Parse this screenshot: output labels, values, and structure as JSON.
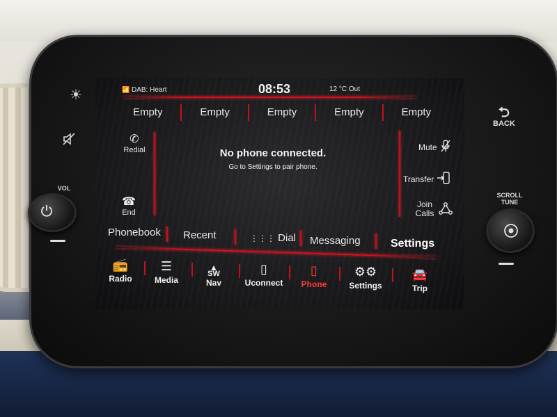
{
  "status": {
    "source": "DAB: Heart",
    "time": "08:53",
    "temperature": "12 °C Out"
  },
  "presets": [
    "Empty",
    "Empty",
    "Empty",
    "Empty",
    "Empty"
  ],
  "left_actions": {
    "redial": "Redial",
    "end": "End"
  },
  "right_actions": {
    "mute": "Mute",
    "transfer": "Transfer",
    "join_calls": "Join Calls"
  },
  "message": {
    "title": "No phone connected.",
    "subtitle": "Go to Settings to pair phone."
  },
  "tabs": [
    "Phonebook",
    "Recent",
    "Dial",
    "Messaging",
    "Settings"
  ],
  "active_tab": "Settings",
  "nav": [
    {
      "label": "Radio",
      "icon": "radio-icon"
    },
    {
      "label": "Media",
      "icon": "media-icon"
    },
    {
      "label": "Nav",
      "icon": "nav-icon",
      "glyph": "SW"
    },
    {
      "label": "Uconnect",
      "icon": "uconnect-icon"
    },
    {
      "label": "Phone",
      "icon": "phone-icon"
    },
    {
      "label": "Settings",
      "icon": "settings-icon"
    },
    {
      "label": "Trip",
      "icon": "trip-icon"
    }
  ],
  "active_nav": "Phone",
  "hardware": {
    "vol_label": "VOL",
    "scroll_tune_label": "SCROLL TUNE",
    "back_label": "BACK"
  },
  "colors": {
    "accent": "#d3121f",
    "active_text": "#ff3a3a",
    "screen_bg": "#18181a"
  }
}
